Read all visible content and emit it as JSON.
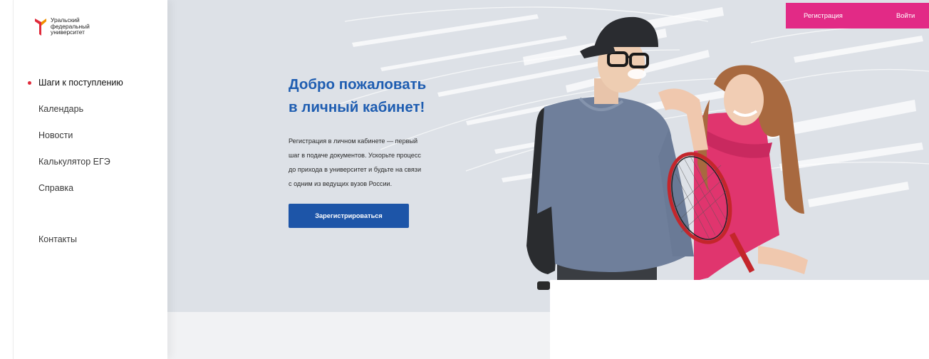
{
  "brand": {
    "logo_lines": [
      "Уральский",
      "федеральный",
      "университет"
    ],
    "accent_red": "#e02a3a",
    "accent_orange": "#f29100"
  },
  "nav": {
    "items": [
      {
        "label": "Шаги к поступлению",
        "active": true
      },
      {
        "label": "Календарь"
      },
      {
        "label": "Новости"
      },
      {
        "label": "Калькулятор ЕГЭ"
      },
      {
        "label": "Справка"
      },
      {
        "label": "Контакты"
      }
    ]
  },
  "header": {
    "register_label": "Регистрация",
    "login_label": "Войти",
    "bar_color": "#e22a86"
  },
  "hero": {
    "title_lines": [
      "Добро пожаловать",
      "в личный кабинет!"
    ],
    "text_lines": [
      "Регистрация в личном кабинете — первый",
      "шаг в подаче документов. Ускорьте процесс",
      "до прихода в университет и будьте на связи",
      "с одним из ведущих вузов России."
    ],
    "cta_label": "Зарегистрироваться",
    "title_color": "#1e5db1",
    "button_color": "#1d55a8",
    "background": "#dde1e7"
  }
}
